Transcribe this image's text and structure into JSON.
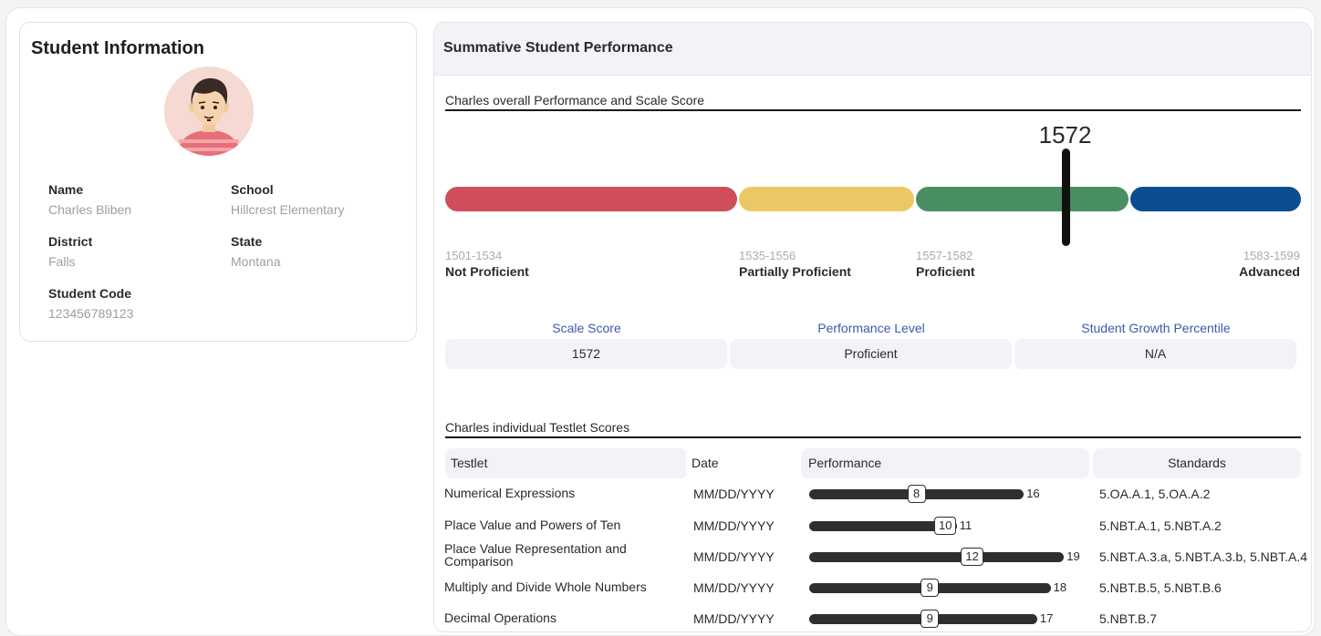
{
  "student_card": {
    "title": "Student Information",
    "fields": [
      {
        "label": "Name",
        "value": "Charles Bliben"
      },
      {
        "label": "School",
        "value": "Hillcrest Elementary"
      },
      {
        "label": "District",
        "value": "Falls"
      },
      {
        "label": "State",
        "value": "Montana"
      },
      {
        "label": "Student Code",
        "value": "123456789123"
      }
    ]
  },
  "performance": {
    "title": "Summative Student Performance",
    "overall_title": "Charles overall Performance and Scale Score",
    "score": "1572",
    "score_value": 1572,
    "scale": {
      "min": 1501,
      "max": 1599,
      "bands": [
        {
          "range": "1501-1534",
          "level": "Not Proficient",
          "color": "#d04e5c"
        },
        {
          "range": "1535-1556",
          "level": "Partially Proficient",
          "color": "#ecc865"
        },
        {
          "range": "1557-1582",
          "level": "Proficient",
          "color": "#4a8f63"
        },
        {
          "range": "1583-1599",
          "level": "Advanced",
          "color": "#0a4e91"
        }
      ]
    },
    "summary": {
      "headers": [
        "Scale Score",
        "Performance Level",
        "Student Growth Percentile"
      ],
      "values": [
        "1572",
        "Proficient",
        "N/A"
      ]
    },
    "testlets": {
      "title": "Charles individual Testlet Scores",
      "headers": {
        "testlet": "Testlet",
        "date": "Date",
        "performance": "Performance",
        "standards": "Standards"
      },
      "rows": [
        {
          "name": "Numerical Expressions",
          "date": "MM/DD/YYYY",
          "score": 8,
          "max": 16,
          "standards": "5.OA.A.1, 5.OA.A.2"
        },
        {
          "name": "Place Value and Powers of Ten",
          "date": "MM/DD/YYYY",
          "score": 10,
          "max": 11,
          "standards": "5.NBT.A.1, 5.NBT.A.2"
        },
        {
          "name": "Place Value Representation and Comparison",
          "date": "MM/DD/YYYY",
          "score": 12,
          "max": 19,
          "standards": "5.NBT.A.3.a, 5.NBT.A.3.b, 5.NBT.A.4"
        },
        {
          "name": "Multiply and Divide Whole Numbers",
          "date": "MM/DD/YYYY",
          "score": 9,
          "max": 18,
          "standards": "5.NBT.B.5, 5.NBT.B.6"
        },
        {
          "name": "Decimal Operations",
          "date": "MM/DD/YYYY",
          "score": 9,
          "max": 17,
          "standards": "5.NBT.B.7"
        }
      ]
    }
  }
}
